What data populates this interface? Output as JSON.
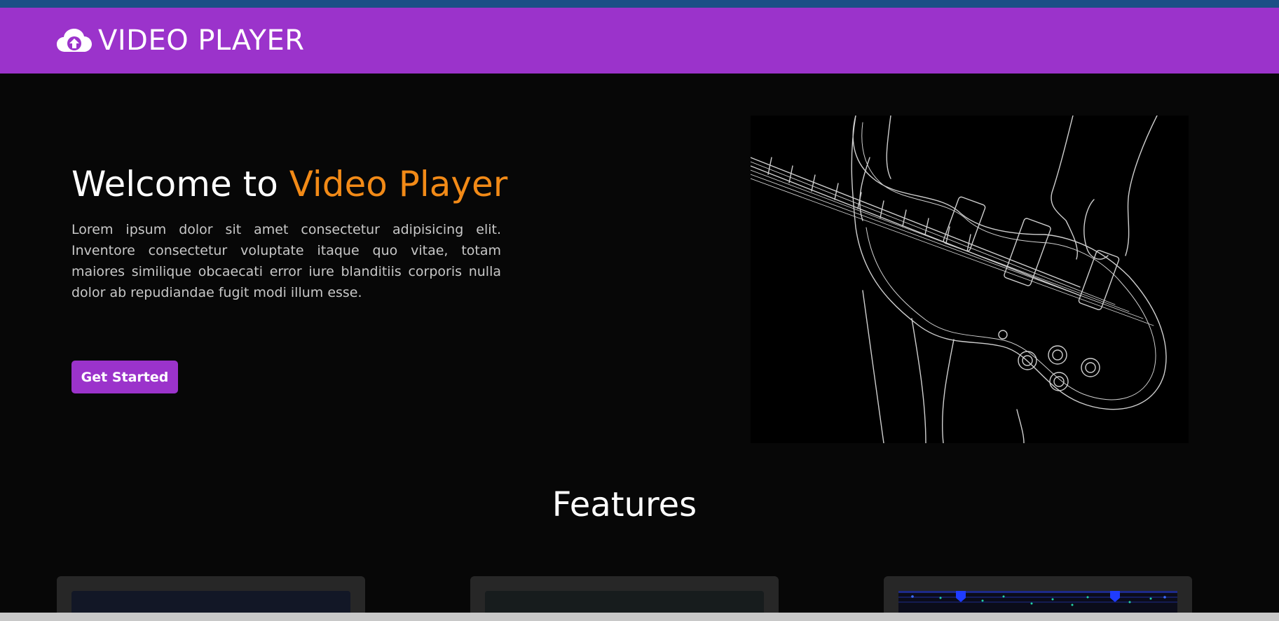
{
  "brand": {
    "icon": "cloud-upload-icon",
    "name": "VIDEO PLAYER"
  },
  "hero": {
    "title_prefix": "Welcome to",
    "title_highlight": "Video Player",
    "description": "Lorem ipsum dolor sit amet consectetur adipisicing elit. Inventore consectetur voluptate itaque quo vitae, totam maiores similique obcaecati error iure blanditiis corporis nulla dolor ab repudiandae fugit modi illum esse.",
    "cta_label": "Get Started",
    "image": "guitar-line-art"
  },
  "features": {
    "heading": "Features",
    "cards": [
      {
        "thumbnail": "dark-blue-thumbnail"
      },
      {
        "thumbnail": "dark-gray-thumbnail"
      },
      {
        "thumbnail": "audio-visualizer-thumbnail"
      }
    ]
  },
  "colors": {
    "navbar": "#9b33cb",
    "accent": "#f28a17",
    "background": "#070707",
    "top_strip": "#1b4f86",
    "card": "#272727"
  }
}
